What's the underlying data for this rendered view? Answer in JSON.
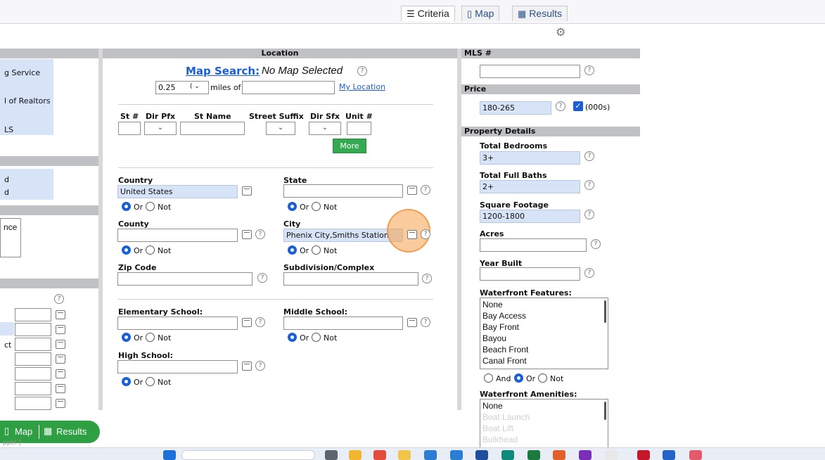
{
  "tabs": [
    {
      "label": "Criteria",
      "icon": "sliders-icon"
    },
    {
      "label": "Map",
      "icon": "map-icon"
    },
    {
      "label": "Results",
      "icon": "grid-icon"
    }
  ],
  "left": {
    "items1": [
      "g Service",
      "l of Realtors",
      "LS"
    ],
    "items2": [
      "d",
      "d"
    ],
    "item3": "nce",
    "ct_label": "ct"
  },
  "location": {
    "header": "Location",
    "map_search_label": "Map Search:",
    "map_status": "No Map Selected",
    "radius_value": "0.25",
    "radius_unit": "miles of",
    "my_location": "My Location",
    "address_labels": [
      "St #",
      "Dir Pfx",
      "St Name",
      "Street Suffix",
      "Dir Sfx",
      "Unit #"
    ],
    "more": "More",
    "country_label": "Country",
    "country_value": "United States",
    "state_label": "State",
    "county_label": "County",
    "city_label": "City",
    "city_value": "Phenix City,Smiths Station",
    "zip_label": "Zip Code",
    "subdivision_label": "Subdivision/Complex",
    "elementary_label": "Elementary School:",
    "middle_label": "Middle School:",
    "high_label": "High School:",
    "or": "Or",
    "not": "Not",
    "and": "And"
  },
  "right": {
    "mls_header": "MLS #",
    "price_header": "Price",
    "price_value": "180-265",
    "price_unit": "(000s)",
    "details_header": "Property Details",
    "bedrooms_label": "Total Bedrooms",
    "bedrooms_value": "3+",
    "baths_label": "Total Full Baths",
    "baths_value": "2+",
    "sqft_label": "Square Footage",
    "sqft_value": "1200-1800",
    "acres_label": "Acres",
    "year_label": "Year Built",
    "wf_features_label": "Waterfront Features:",
    "wf_features": [
      "None",
      "Bay Access",
      "Bay Front",
      "Bayou",
      "Beach Front",
      "Canal Front"
    ],
    "wf_amenities_label": "Waterfront Amenities:",
    "wf_amenities": [
      "None",
      "Boat Launch",
      "Boat Lift",
      "Bulkhead"
    ]
  },
  "bottom": {
    "map": "Map",
    "results": "Results",
    "stray": "ppel ]"
  },
  "colors": {
    "accent": "#1a5fd6",
    "field_blue": "#d7e3f7",
    "header_gray": "#bfc1c4",
    "green": "#2ea043",
    "highlight": "#f5a04a"
  }
}
